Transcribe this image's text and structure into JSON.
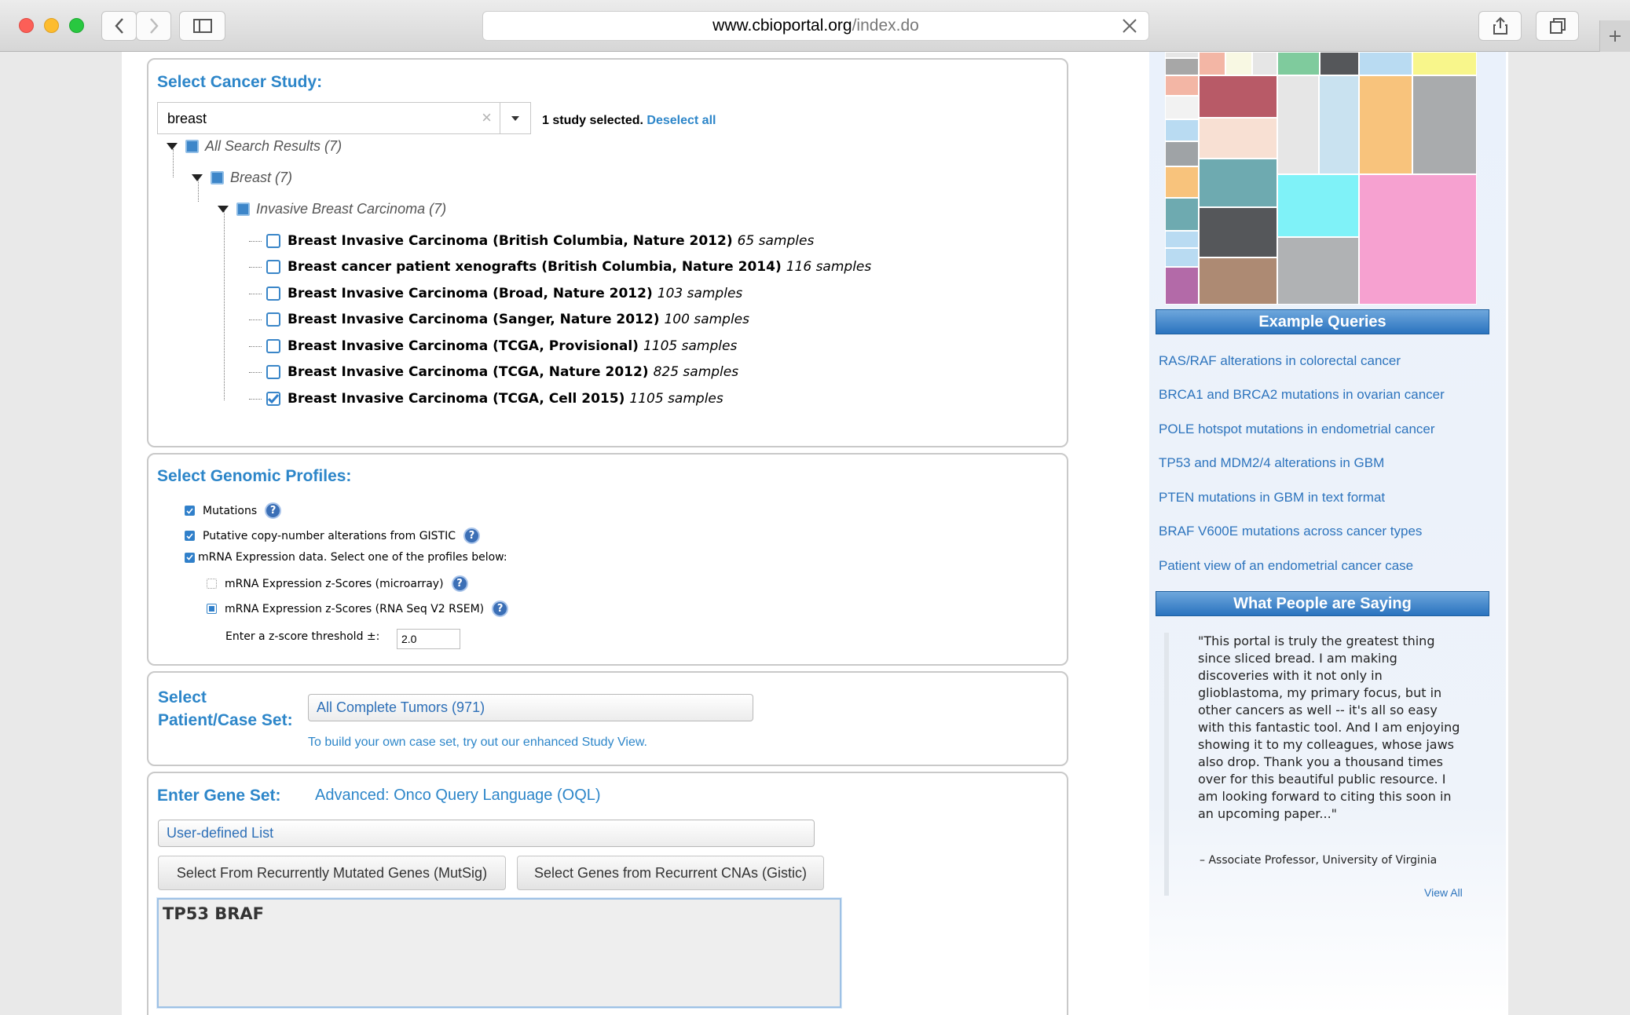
{
  "browser": {
    "url_host": "www.cbioportal.org",
    "url_path": "/index.do"
  },
  "study": {
    "title": "Select Cancer Study:",
    "search_value": "breast",
    "status_text": "1 study selected.",
    "deselect_label": "Deselect all",
    "tree_root": "All Search Results (7)",
    "tree_group": "Breast (7)",
    "tree_subgroup": "Invasive Breast Carcinoma (7)",
    "studies": [
      {
        "name": "Breast Invasive Carcinoma (British Columbia, Nature 2012)",
        "count": "65 samples",
        "checked": false
      },
      {
        "name": "Breast cancer patient xenografts (British Columbia, Nature 2014)",
        "count": "116 samples",
        "checked": false
      },
      {
        "name": "Breast Invasive Carcinoma (Broad, Nature 2012)",
        "count": "103 samples",
        "checked": false
      },
      {
        "name": "Breast Invasive Carcinoma (Sanger, Nature 2012)",
        "count": "100 samples",
        "checked": false
      },
      {
        "name": "Breast Invasive Carcinoma (TCGA, Provisional)",
        "count": "1105 samples",
        "checked": false
      },
      {
        "name": "Breast Invasive Carcinoma (TCGA, Nature 2012)",
        "count": "825 samples",
        "checked": false
      },
      {
        "name": "Breast Invasive Carcinoma (TCGA, Cell 2015)",
        "count": "1105 samples",
        "checked": true
      }
    ]
  },
  "profiles": {
    "title": "Select Genomic Profiles:",
    "mutations": "Mutations",
    "cna": "Putative copy-number alterations from GISTIC",
    "mrna": "mRNA Expression data. Select one of the profiles below:",
    "mrna_microarray": "mRNA Expression z-Scores (microarray)",
    "mrna_rnaseq": "mRNA Expression z-Scores (RNA Seq V2 RSEM)",
    "z_label": "Enter a z-score threshold ±:",
    "z_value": "2.0",
    "help_glyph": "?"
  },
  "caseset": {
    "title_line1": "Select",
    "title_line2": "Patient/Case Set:",
    "selected": "All Complete Tumors (971)",
    "hint": "To build your own case set, try out our enhanced Study View."
  },
  "geneset": {
    "title": "Enter Gene Set:",
    "oql_link": "Advanced: Onco Query Language (OQL)",
    "list_selected": "User-defined List",
    "mutsig_button": "Select From Recurrently Mutated Genes (MutSig)",
    "gistic_button": "Select Genes from Recurrent CNAs (Gistic)",
    "genes": "TP53 BRAF"
  },
  "sidebar": {
    "example_title": "Example Queries",
    "examples": [
      "RAS/RAF alterations in colorectal cancer",
      "BRCA1 and BRCA2 mutations in ovarian cancer",
      "POLE hotspot mutations in endometrial cancer",
      "TP53 and MDM2/4 alterations in GBM",
      "PTEN mutations in GBM in text format",
      "BRAF V600E mutations across cancer types",
      "Patient view of an endometrial cancer case"
    ],
    "people_title": "What People are Saying",
    "quote": "\"This portal is truly the greatest thing since sliced bread. I am making discoveries with it not only in glioblastoma, my primary focus, but in other cancers as well -- it's all so easy with this fantastic tool. And I am enjoying showing it to my colleagues, whose jaws also drop. Thank you a thousand times over for this beautiful public resource. I am looking forward to citing this soon in an upcoming paper...\"",
    "author": "– Associate Professor, University of Virginia",
    "view_all": "View All"
  },
  "colors": {
    "accent": "#2d86c9",
    "header_bar": "#2a73bf"
  }
}
